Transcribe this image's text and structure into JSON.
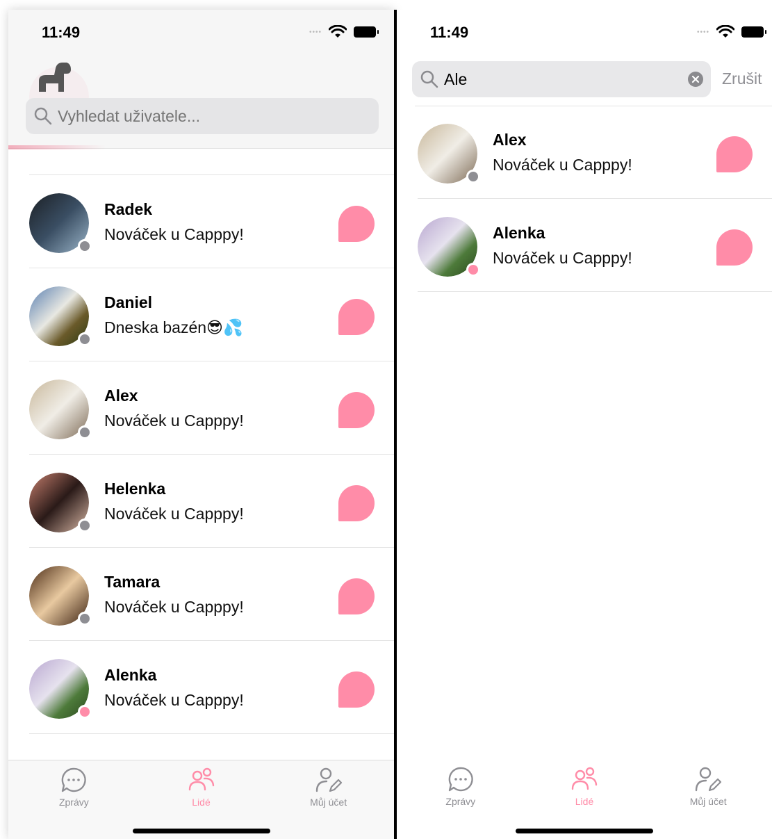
{
  "colors": {
    "accent": "#ff8ca8",
    "offline": "#8e8e93",
    "online": "#ff8ca8"
  },
  "left": {
    "status_time": "11:49",
    "search": {
      "placeholder": "Vyhledat uživatele..."
    },
    "people": [
      {
        "name": "Radek",
        "message": "Nováček u Capppy!",
        "status": "offline",
        "avatar": "man-portrait"
      },
      {
        "name": "Daniel",
        "message": "Dneska bazén😎💦",
        "status": "offline",
        "avatar": "waterfall"
      },
      {
        "name": "Alex",
        "message": "Nováček u Capppy!",
        "status": "offline",
        "avatar": "man-balcony"
      },
      {
        "name": "Helenka",
        "message": "Nováček u Capppy!",
        "status": "offline",
        "avatar": "woman-selfie"
      },
      {
        "name": "Tamara",
        "message": "Nováček u Capppy!",
        "status": "offline",
        "avatar": "woman-portrait"
      },
      {
        "name": "Alenka",
        "message": "Nováček u Capppy!",
        "status": "online",
        "avatar": "waterfall-green"
      }
    ],
    "tabs": [
      {
        "label": "Zprávy",
        "icon": "chat-icon",
        "active": false
      },
      {
        "label": "Lidé",
        "icon": "people-icon",
        "active": true
      },
      {
        "label": "Můj účet",
        "icon": "account-edit-icon",
        "active": false
      }
    ]
  },
  "right": {
    "status_time": "11:49",
    "search": {
      "value": "Ale",
      "cancel_label": "Zrušit"
    },
    "results": [
      {
        "name": "Alex",
        "message": "Nováček u Capppy!",
        "status": "offline",
        "avatar": "man-balcony"
      },
      {
        "name": "Alenka",
        "message": "Nováček u Capppy!",
        "status": "online",
        "avatar": "waterfall-green"
      }
    ],
    "tabs": [
      {
        "label": "Zprávy",
        "icon": "chat-icon",
        "active": false
      },
      {
        "label": "Lidé",
        "icon": "people-icon",
        "active": true
      },
      {
        "label": "Můj účet",
        "icon": "account-edit-icon",
        "active": false
      }
    ]
  }
}
